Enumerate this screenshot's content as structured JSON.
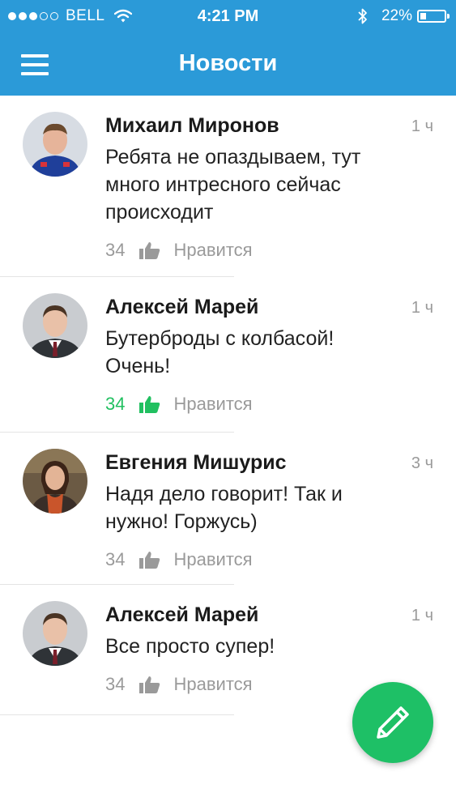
{
  "status_bar": {
    "carrier": "BELL",
    "time": "4:21 PM",
    "battery": "22%",
    "icons": [
      "signal-dots",
      "wifi-icon",
      "bluetooth-icon",
      "battery-icon"
    ]
  },
  "nav": {
    "title": "Новости",
    "menu_icon": "hamburger-menu-icon"
  },
  "colors": {
    "header": "#2b9ad8",
    "accent_green": "#1ec066",
    "liked_green": "#21c060",
    "muted": "#9a9a9a"
  },
  "posts": [
    {
      "author": "Михаил Миронов",
      "time": "1 ч",
      "text": "Ребята не опаздываем, тут много интресного сейчас происходит",
      "likes": "34",
      "like_label": "Нравится",
      "liked": false
    },
    {
      "author": "Алексей Марей",
      "time": "1 ч",
      "text": "Бутерброды с колбасой! Очень!",
      "likes": "34",
      "like_label": "Нравится",
      "liked": true
    },
    {
      "author": "Евгения Мишурис",
      "time": "3 ч",
      "text": "Надя дело говорит! Так и нужно! Горжусь)",
      "likes": "34",
      "like_label": "Нравится",
      "liked": false
    },
    {
      "author": "Алексей Марей",
      "time": "1 ч",
      "text": "Все просто супер!",
      "likes": "34",
      "like_label": "Нравится",
      "liked": false
    }
  ],
  "fab": {
    "icon": "pencil-icon"
  }
}
